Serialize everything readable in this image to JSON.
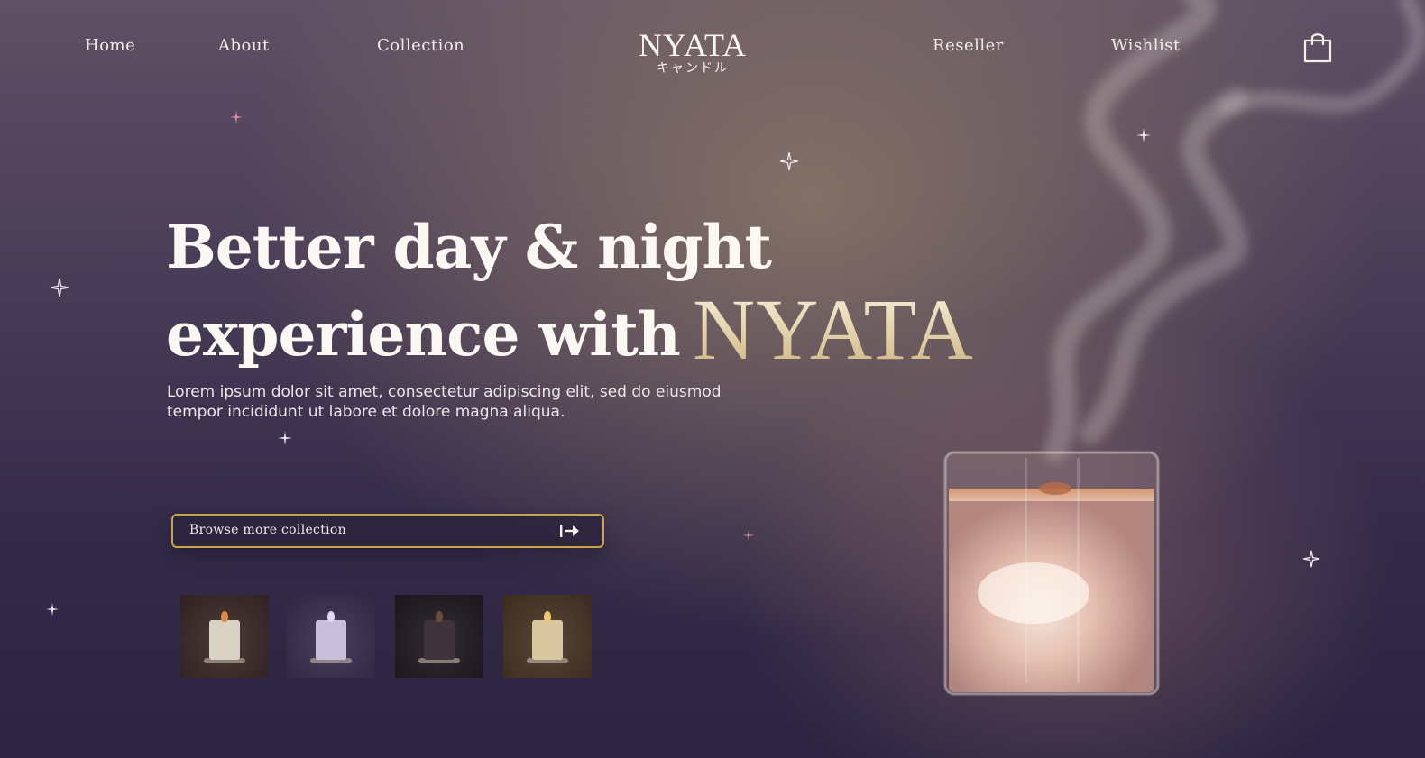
{
  "nav": {
    "home": "Home",
    "about": "About",
    "collection": "Collection",
    "reseller": "Reseller",
    "wishlist": "Wishlist",
    "cart_icon": "shopping-bag-icon"
  },
  "logo": {
    "main": "NYATA",
    "sub": "キャンドル"
  },
  "hero": {
    "line1": "Better day & night",
    "line2": "experience with",
    "brand": "NYATA",
    "description": "Lorem ipsum dolor sit amet, consectetur adipiscing elit, sed do eiusmod tempor incididunt ut labore et dolore magna aliqua.",
    "cta_label": "Browse more collection",
    "cta_icon": "arrow-right-to-bar-icon"
  },
  "thumbnails": [
    {
      "name": "candle-thumb-amber",
      "bg": "#3b2a28",
      "glass": "#d9d2c3",
      "flame": "#e08a4a"
    },
    {
      "name": "candle-thumb-lavender",
      "bg": "#3a3150",
      "glass": "#c7c0d9",
      "flame": "#e3d6f0"
    },
    {
      "name": "candle-thumb-dark",
      "bg": "#211a22",
      "glass": "#3d3338",
      "flame": "#6b4b3a"
    },
    {
      "name": "candle-thumb-gold",
      "bg": "#4a3626",
      "glass": "#d8c8a0",
      "flame": "#f0c770"
    }
  ],
  "colors": {
    "gold_border": "#c9a44a",
    "text_light": "#fbf7f2",
    "star_pink": "#d98fa6"
  }
}
